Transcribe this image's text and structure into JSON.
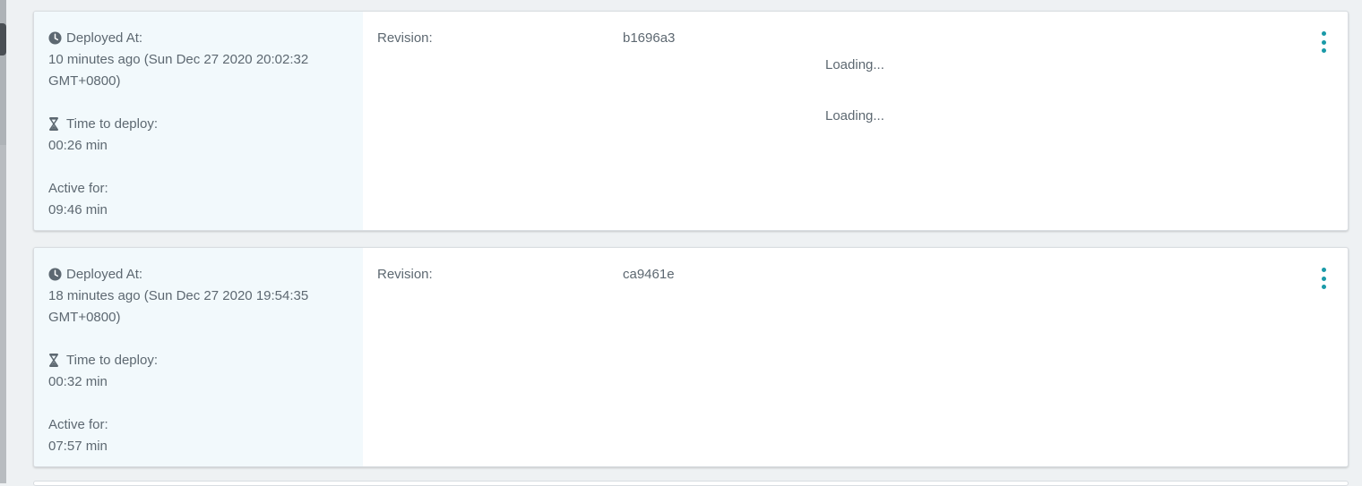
{
  "colors": {
    "page_bg": "#eef1f3",
    "meta_bg": "#f2f9fc",
    "text": "#5d6871",
    "accent": "#1a9aa8"
  },
  "deployments": [
    {
      "deployed_label": "Deployed At:",
      "deployed_value": "10 minutes ago (Sun Dec 27 2020 20:02:32 GMT+0800)",
      "time_label": "Time to deploy:",
      "time_value": "00:26 min",
      "active_label": "Active for:",
      "active_value": "09:46 min",
      "revision_label": "Revision:",
      "revision_value": "b1696a3",
      "loading": [
        "Loading...",
        "Loading..."
      ],
      "clock_icon": "clock-icon",
      "hourglass_icon": "hourglass-icon",
      "menu_icon": "more-vertical-icon"
    },
    {
      "deployed_label": "Deployed At:",
      "deployed_value": "18 minutes ago (Sun Dec 27 2020 19:54:35 GMT+0800)",
      "time_label": "Time to deploy:",
      "time_value": "00:32 min",
      "active_label": "Active for:",
      "active_value": "07:57 min",
      "revision_label": "Revision:",
      "revision_value": "ca9461e",
      "clock_icon": "clock-icon",
      "hourglass_icon": "hourglass-icon",
      "menu_icon": "more-vertical-icon"
    }
  ]
}
